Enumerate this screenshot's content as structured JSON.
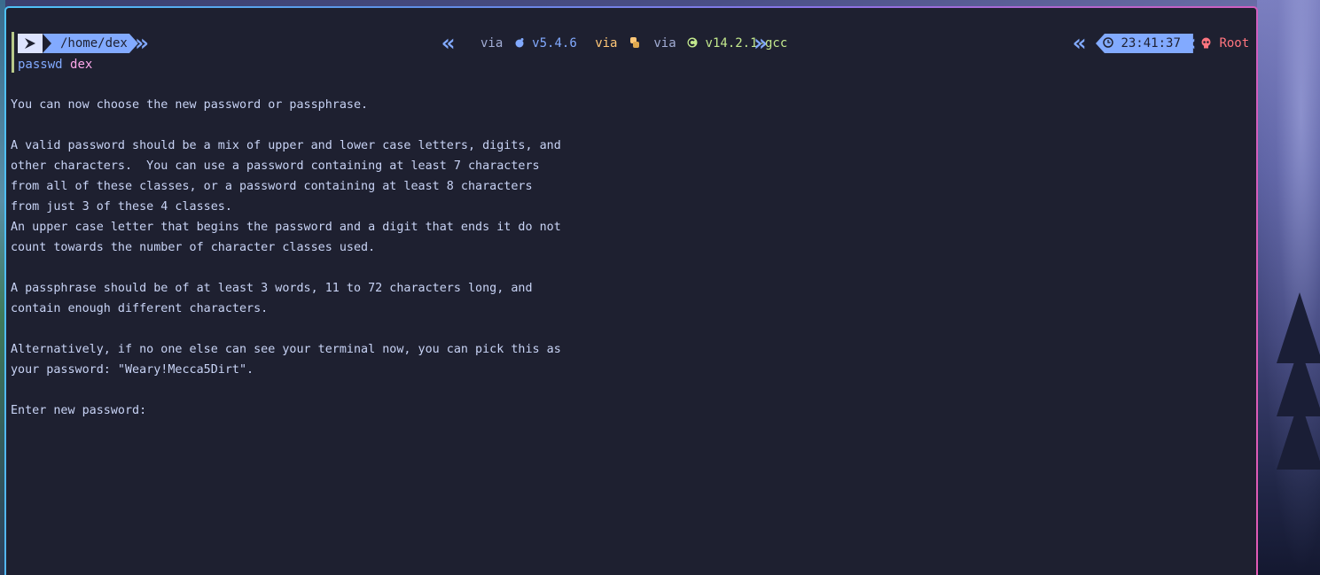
{
  "prompt": {
    "arch_icon": "arch-logo-icon",
    "path": "/home/dex",
    "segments": {
      "via1": "via",
      "perl_icon": "perl-icon",
      "perl_version": "v5.4.6",
      "via2": "via",
      "python_icon": "python-icon",
      "via3": "via",
      "c_icon": "c-lang-icon",
      "gcc_version": "v14.2.1-gcc"
    },
    "clock_icon": "clock-icon",
    "time": "23:41:37",
    "skull_icon": "skull-icon",
    "user": "Root"
  },
  "command": {
    "program": "passwd",
    "argument": "dex"
  },
  "output_lines": [
    "You can now choose the new password or passphrase.",
    "",
    "A valid password should be a mix of upper and lower case letters, digits, and",
    "other characters.  You can use a password containing at least 7 characters",
    "from all of these classes, or a password containing at least 8 characters",
    "from just 3 of these 4 classes.",
    "An upper case letter that begins the password and a digit that ends it do not",
    "count towards the number of character classes used.",
    "",
    "A passphrase should be of at least 3 words, 11 to 72 characters long, and",
    "contain enough different characters.",
    "",
    "Alternatively, if no one else can see your terminal now, you can pick this as",
    "your password: \"Weary!Mecca5Dirt\".",
    "",
    "Enter new password:"
  ],
  "colors": {
    "background": "#1e2030",
    "text": "#c8d3f5",
    "accent_blue": "#82aaff",
    "accent_pink": "#fca7ea",
    "accent_yellow": "#ffc777",
    "accent_green": "#c3e88d",
    "accent_red": "#ff757f"
  }
}
